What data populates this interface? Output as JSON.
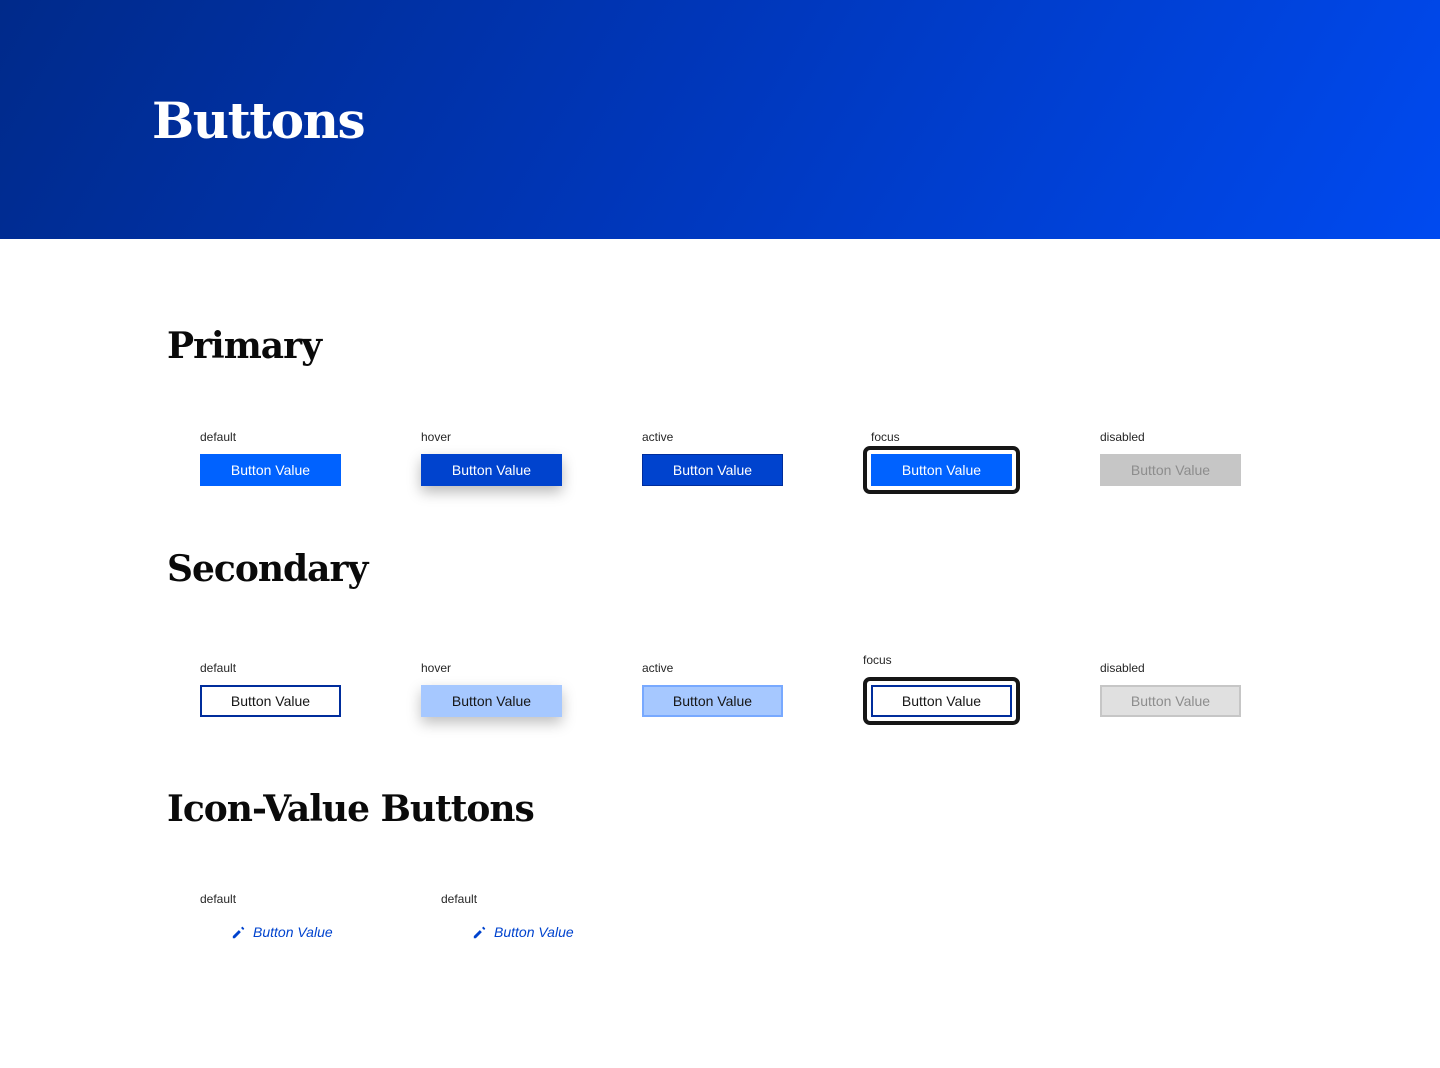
{
  "hero": {
    "title": "Buttons"
  },
  "primary": {
    "title": "Primary",
    "states": [
      {
        "label": "default",
        "button": "Button Value"
      },
      {
        "label": "hover",
        "button": "Button Value"
      },
      {
        "label": "active",
        "button": "Button Value"
      },
      {
        "label": "focus",
        "button": "Button Value"
      },
      {
        "label": "disabled",
        "button": "Button Value"
      }
    ]
  },
  "secondary": {
    "title": "Secondary",
    "states": [
      {
        "label": "default",
        "button": "Button Value"
      },
      {
        "label": "hover",
        "button": "Button Value"
      },
      {
        "label": "active",
        "button": "Button Value"
      },
      {
        "label": "focus",
        "button": "Button Value"
      },
      {
        "label": "disabled",
        "button": "Button Value"
      }
    ]
  },
  "icon_value": {
    "title": "Icon-Value Buttons",
    "items": [
      {
        "label": "default",
        "button": "Button Value",
        "icon": "pencil-icon"
      },
      {
        "label": "default",
        "button": "Button Value",
        "icon": "pencil-icon"
      }
    ]
  },
  "colors": {
    "hero_gradient_start": "#002a8a",
    "hero_gradient_end": "#004af0",
    "primary": "#0062ff",
    "primary_hover": "#0043ce",
    "secondary_hover": "#a6c8ff",
    "disabled": "#c6c6c6",
    "focus_ring": "#161616",
    "icon_button_text": "#0043ce"
  }
}
